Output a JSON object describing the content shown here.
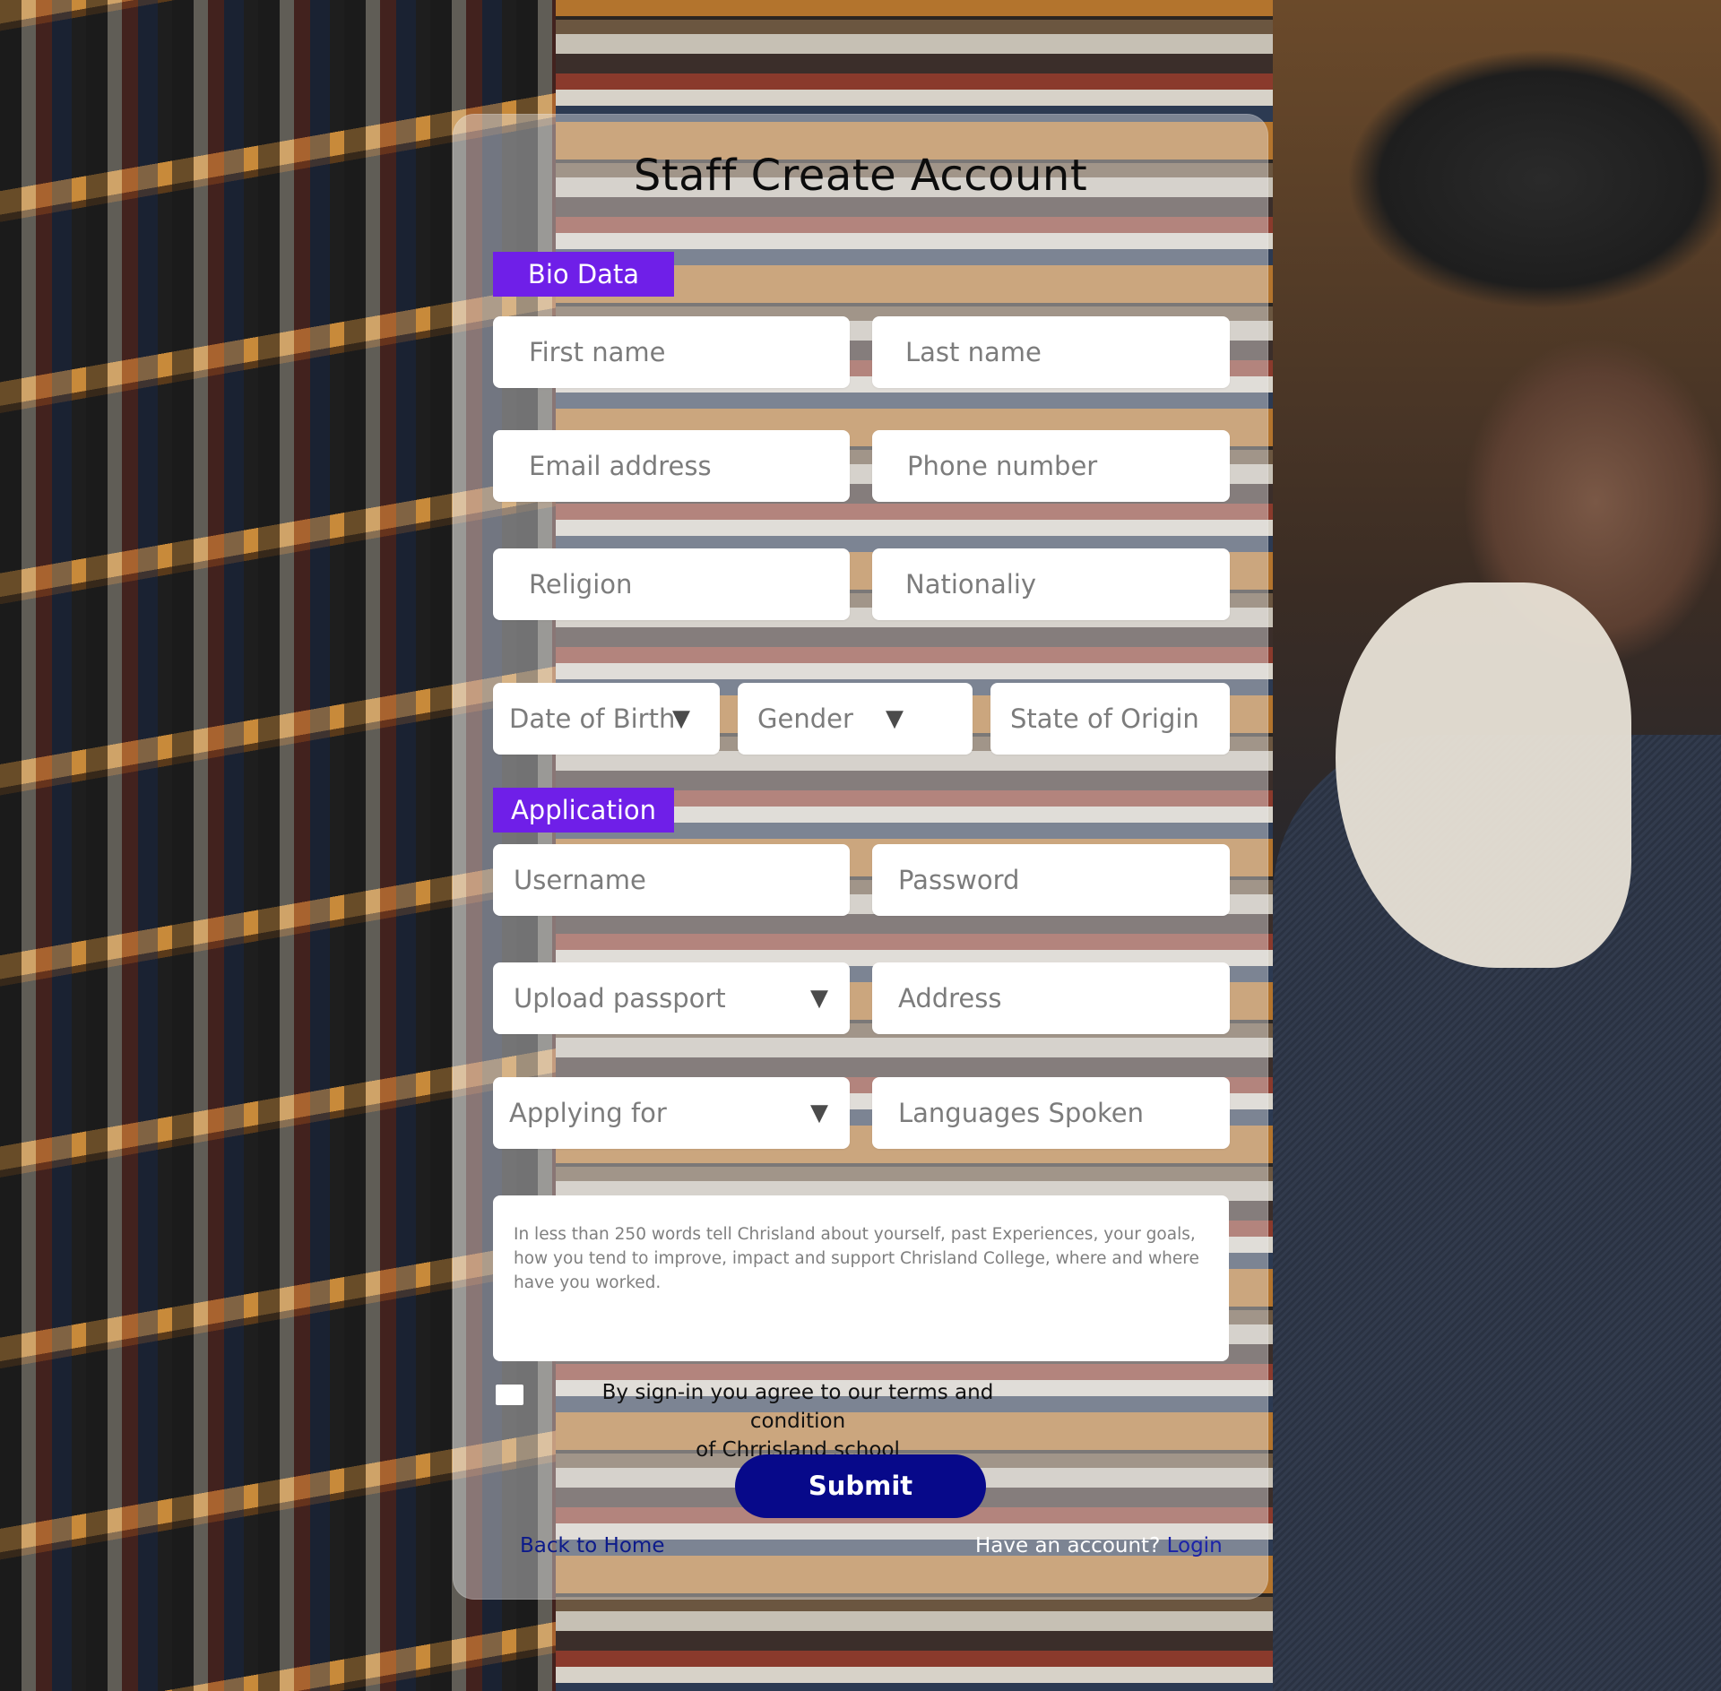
{
  "page": {
    "title": "Staff Create Account"
  },
  "sections": {
    "bio_data": "Bio Data",
    "application": "Application"
  },
  "bio": {
    "first_name": "First name",
    "last_name": "Last name",
    "email": "Email address",
    "phone": "Phone number",
    "religion": "Religion",
    "nationality": "Nationaliy",
    "dob": "Date of  Birth",
    "gender": "Gender",
    "state_of_origin": "State of Origin"
  },
  "application": {
    "username": "Username",
    "password": "Password",
    "upload_passport": "Upload passport",
    "address": "Address",
    "applying_for": "Applying for",
    "languages_spoken": "Languages Spoken",
    "about_placeholder": "In less than 250 words tell Chrisland about yourself, past Experiences, your goals, how you tend to improve, impact  and support Chrisland College, where and where have you worked."
  },
  "terms": {
    "line1": "By sign-in you agree to our terms and condition",
    "line2": "of Chrrisland school"
  },
  "actions": {
    "submit": "Submit",
    "back_home": "Back to Home",
    "have_account": "Have an account?",
    "login": "Login"
  },
  "icons": {
    "dropdown": "▼"
  },
  "colors": {
    "section_tag": "#6f1fe8",
    "submit_button": "#07098a",
    "link": "#0c1a8a"
  }
}
